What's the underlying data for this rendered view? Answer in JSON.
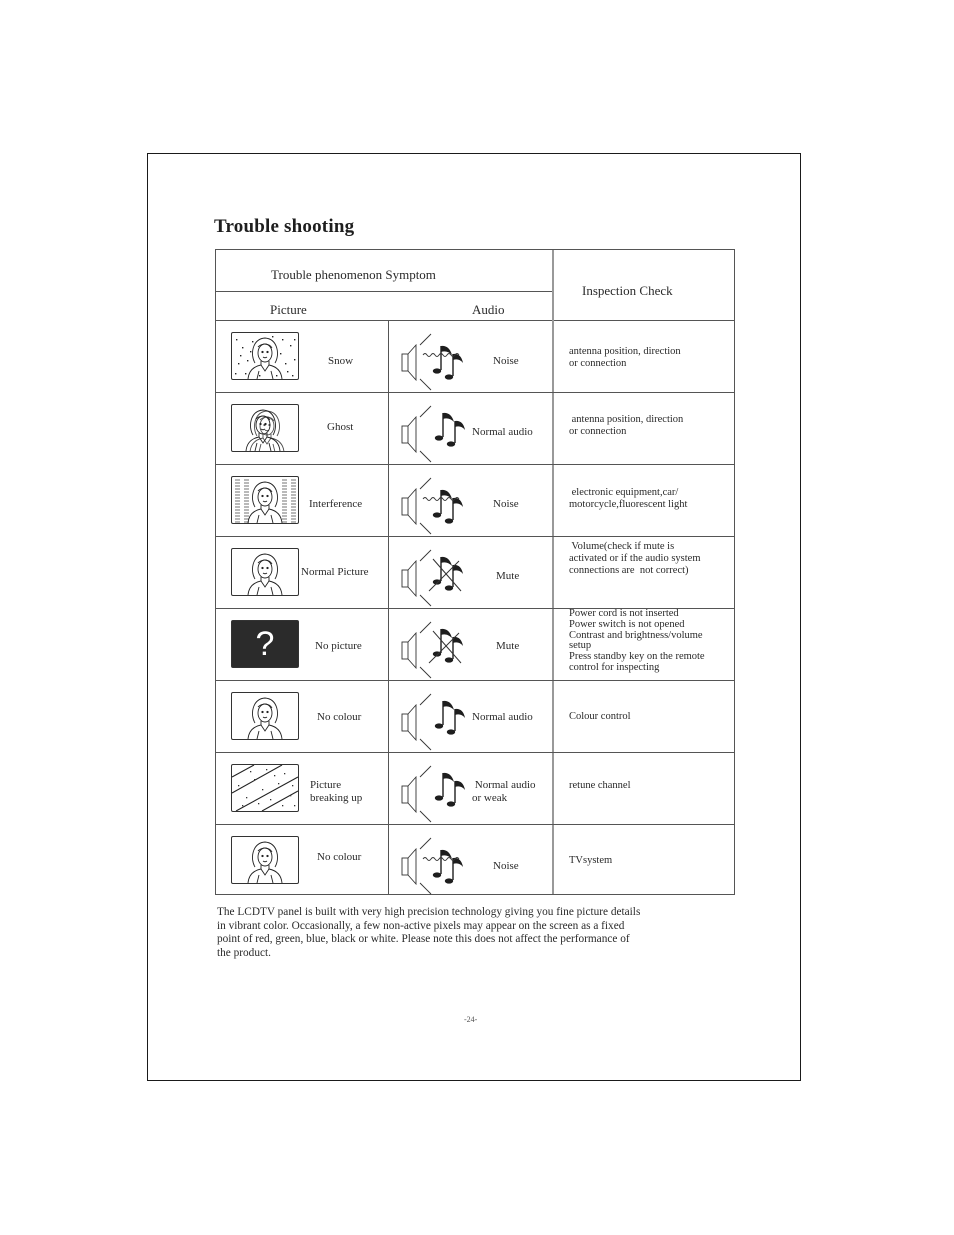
{
  "page": {
    "title": "Trouble shooting",
    "page_number": "-24-"
  },
  "table": {
    "header": {
      "symptom_group": "Trouble phenomenon Symptom",
      "picture": "Picture",
      "audio": "Audio",
      "inspection": "Inspection Check"
    },
    "rows": [
      {
        "picture_icon": "tv-snow-icon",
        "picture_lines": [
          "Snow"
        ],
        "audio_icon": "speaker-noise-icon",
        "audio_lines": [
          "Noise"
        ],
        "inspection_lines": [
          "antenna position, direction",
          "or connection"
        ]
      },
      {
        "picture_icon": "tv-ghost-icon",
        "picture_lines": [
          "Ghost"
        ],
        "audio_icon": "speaker-normal-audio-icon",
        "audio_lines": [
          "Normal audio"
        ],
        "inspection_lines": [
          " antenna position, direction",
          "or connection"
        ]
      },
      {
        "picture_icon": "tv-interference-icon",
        "picture_lines": [
          "Interference"
        ],
        "audio_icon": "speaker-noise-icon",
        "audio_lines": [
          "Noise"
        ],
        "inspection_lines": [
          " electronic equipment,car/",
          "motorcycle,fluorescent light"
        ]
      },
      {
        "picture_icon": "tv-normal-picture-icon",
        "picture_lines": [
          "Normal Picture"
        ],
        "audio_icon": "speaker-mute-icon",
        "audio_lines": [
          "Mute"
        ],
        "inspection_lines": [
          " Volume(check if mute is",
          "activated or if the audio system",
          "connections are  not correct)"
        ]
      },
      {
        "picture_icon": "tv-no-picture-icon",
        "picture_symbol": "?",
        "picture_lines": [
          "No picture"
        ],
        "audio_icon": "speaker-mute-icon",
        "audio_lines": [
          "Mute"
        ],
        "inspection_lines": [
          "Power cord is not inserted",
          "Power switch is not opened",
          "Contrast and brightness/volume",
          "setup",
          "Press standby key on the remote",
          "control for inspecting"
        ]
      },
      {
        "picture_icon": "tv-normal-picture-icon",
        "picture_lines": [
          "No colour"
        ],
        "audio_icon": "speaker-normal-audio-icon",
        "audio_lines": [
          "Normal audio"
        ],
        "inspection_lines": [
          "Colour control"
        ]
      },
      {
        "picture_icon": "tv-breaking-up-icon",
        "picture_lines": [
          "Picture",
          "breaking up"
        ],
        "audio_icon": "speaker-normal-audio-icon",
        "audio_lines": [
          " Normal audio",
          "or weak"
        ],
        "inspection_lines": [
          "retune channel"
        ]
      },
      {
        "picture_icon": "tv-normal-picture-icon",
        "picture_lines": [
          "No colour"
        ],
        "audio_icon": "speaker-noise-icon",
        "audio_lines": [
          "Noise"
        ],
        "inspection_lines": [
          "TVsystem"
        ]
      }
    ]
  },
  "footnote": {
    "lines": [
      "The LCDTV panel is built with very high precision technology giving you fine picture details",
      "in vibrant color.  Occasionally, a few non-active pixels may appear on the screen as a fixed",
      "point of red, green, blue, black or white.  Please note this does not affect the performance of",
      "the product."
    ]
  }
}
